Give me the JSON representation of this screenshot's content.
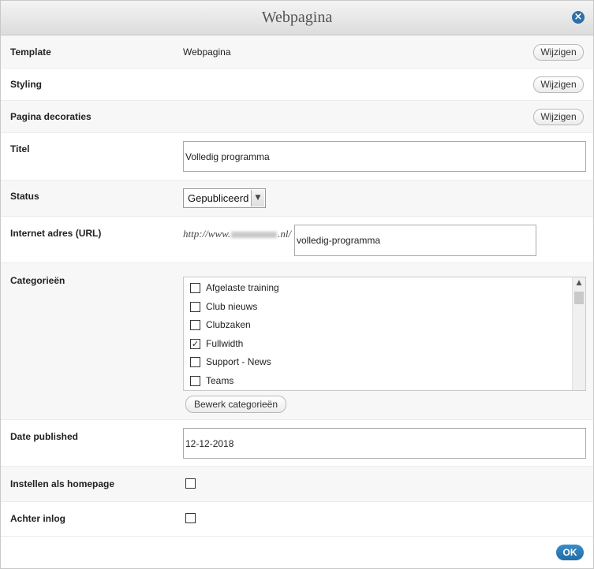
{
  "dialog": {
    "title": "Webpagina",
    "close_icon": "close-icon"
  },
  "fields": {
    "template": {
      "label": "Template",
      "value": "Webpagina",
      "button": "Wijzigen"
    },
    "styling": {
      "label": "Styling",
      "button": "Wijzigen"
    },
    "decorations": {
      "label": "Pagina decoraties",
      "button": "Wijzigen"
    },
    "title": {
      "label": "Titel",
      "value": "Volledig programma"
    },
    "status": {
      "label": "Status",
      "value": "Gepubliceerd"
    },
    "url": {
      "label": "Internet adres (URL)",
      "prefix_start": "http://www.",
      "prefix_end": ".nl/",
      "value": "volledig-programma"
    },
    "categories": {
      "label": "Categorieën",
      "items": [
        {
          "label": "Afgelaste training",
          "checked": false
        },
        {
          "label": "Club nieuws",
          "checked": false
        },
        {
          "label": "Clubzaken",
          "checked": false
        },
        {
          "label": "Fullwidth",
          "checked": true
        },
        {
          "label": "Support - News",
          "checked": false
        },
        {
          "label": "Teams",
          "checked": false
        }
      ],
      "edit_button": "Bewerk categorieën"
    },
    "date_published": {
      "label": "Date published",
      "value": "12-12-2018"
    },
    "homepage": {
      "label": "Instellen als homepage",
      "checked": false
    },
    "login": {
      "label": "Achter inlog",
      "checked": false
    }
  },
  "footer": {
    "ok_label": "OK"
  },
  "colors": {
    "accent": "#2e6fa8",
    "ok_button": "#216ea7",
    "row_alt": "#f7f7f7"
  }
}
